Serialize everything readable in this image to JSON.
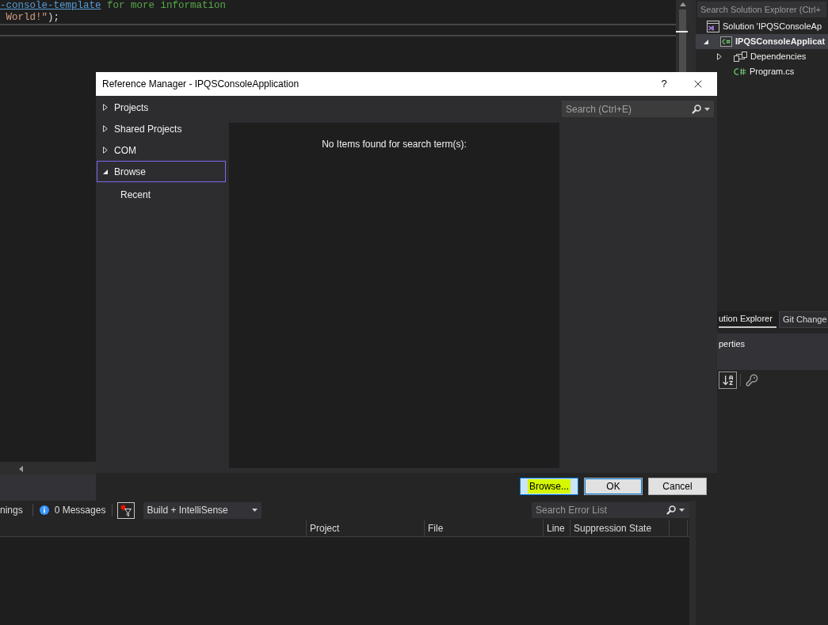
{
  "editor": {
    "lines": [
      {
        "current": false,
        "segments": [
          {
            "kind": "link",
            "text": "-console-template"
          },
          {
            "kind": "comment",
            "text": " for more information"
          }
        ]
      },
      {
        "current": false,
        "segments": [
          {
            "kind": "string",
            "text": " World!\""
          },
          {
            "kind": "plain",
            "text": ");"
          }
        ]
      },
      {
        "current": true
      }
    ]
  },
  "error_list": {
    "toolbar": {
      "warnings": "nings",
      "messages": "0 Messages",
      "scope": "Build + IntelliSense",
      "search": {
        "placeholder": "Search Error List"
      }
    },
    "columns": [
      "Project",
      "File",
      "Line",
      "Suppression State"
    ]
  },
  "solution_explorer": {
    "search": {
      "placeholder": "Search Solution Explorer (Ctrl+"
    },
    "tree": [
      {
        "kind": "solution",
        "label": "Solution 'IPQSConsoleAp",
        "selected": false,
        "children": [
          {
            "kind": "project",
            "label": "IPQSConsoleApplicat",
            "selected": true,
            "expanded": true,
            "children": [
              {
                "kind": "dependencies",
                "label": "Dependencies",
                "selected": false,
                "expanded": false
              },
              {
                "kind": "csharp_file",
                "label": "Program.cs",
                "selected": false
              }
            ]
          }
        ]
      }
    ],
    "tabs": [
      {
        "label": "ution Explorer",
        "selected": true
      },
      {
        "label": "Git Change",
        "selected": false
      }
    ]
  },
  "properties": {
    "title": "perties"
  },
  "dialog": {
    "title": "Reference Manager - IPQSConsoleApplication",
    "help": "?",
    "nav": [
      {
        "label": "Projects",
        "expanded": false,
        "selected": false
      },
      {
        "label": "Shared Projects",
        "expanded": false,
        "selected": false
      },
      {
        "label": "COM",
        "expanded": false,
        "selected": false
      },
      {
        "label": "Browse",
        "expanded": true,
        "selected": true,
        "children": [
          {
            "label": "Recent",
            "selected": false
          }
        ]
      }
    ],
    "search": {
      "placeholder": "Search (Ctrl+E)"
    },
    "message": "No Items found for search term(s):",
    "buttons": [
      {
        "label": "Browse...",
        "hovered": true,
        "default": false,
        "marked": true
      },
      {
        "label": "OK",
        "hovered": false,
        "default": true,
        "marked": false
      },
      {
        "label": "Cancel",
        "hovered": false,
        "default": false,
        "marked": false
      }
    ]
  }
}
